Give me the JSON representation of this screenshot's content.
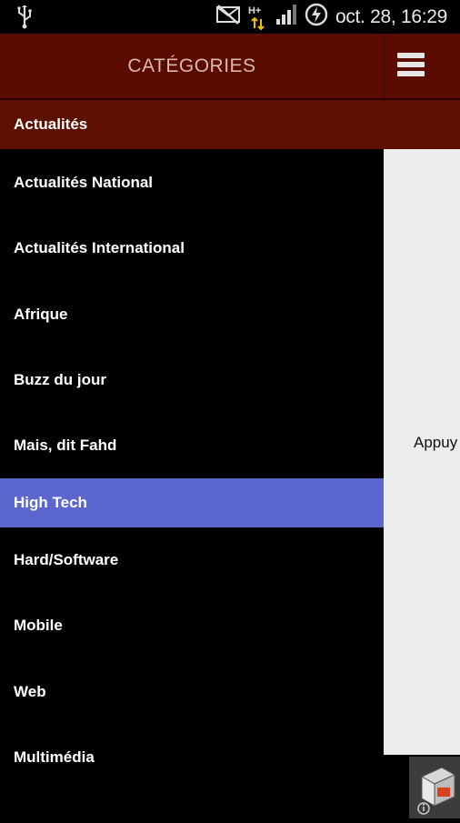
{
  "status_bar": {
    "time": "oct. 28, 16:29",
    "network_type": "H+"
  },
  "header": {
    "title": "CATÉGORIES"
  },
  "section": {
    "label": "Actualités"
  },
  "categories": [
    {
      "label": "Actualités National",
      "selected": false
    },
    {
      "label": "Actualités International",
      "selected": false
    },
    {
      "label": "Afrique",
      "selected": false
    },
    {
      "label": "Buzz du jour",
      "selected": false
    },
    {
      "label": "Mais, dit Fahd",
      "selected": false
    },
    {
      "label": "High Tech",
      "selected": true
    },
    {
      "label": "Hard/Software",
      "selected": false
    },
    {
      "label": "Mobile",
      "selected": false
    },
    {
      "label": "Web",
      "selected": false
    },
    {
      "label": "Multimédia",
      "selected": false
    }
  ],
  "content": {
    "message": "Appuy"
  },
  "colors": {
    "header_bg": "#5a0c00",
    "section_bg": "#5c1000",
    "selected_bg": "#5b67cf",
    "drawer_bg": "#000000",
    "content_bg": "#ececec"
  }
}
